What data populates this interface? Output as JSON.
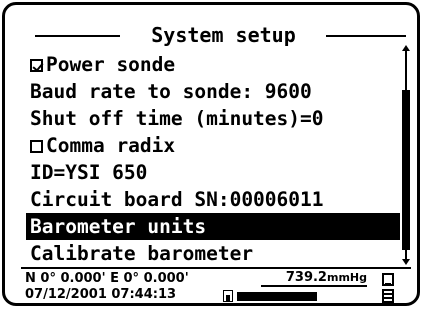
{
  "screen": {
    "title": "System setup",
    "items": [
      {
        "label": "Power sonde",
        "checkbox": true,
        "checked": true
      },
      {
        "label": "Baud rate to sonde: 9600"
      },
      {
        "label": "Shut off time (minutes)=0"
      },
      {
        "label": "Comma radix",
        "checkbox": true,
        "checked": false
      },
      {
        "label": "ID=YSI 650"
      },
      {
        "label": "Circuit board SN:00006011"
      },
      {
        "label": "Barometer units",
        "selected": true
      },
      {
        "label": "Calibrate barometer"
      }
    ]
  },
  "status": {
    "coords": "N 0° 0.000' E  0° 0.000'",
    "datetime": "07/12/2001 07:44:13",
    "baro_value": "739.2",
    "baro_unit": "mmHg",
    "battery_level": 1.0
  },
  "icons": {
    "checkbox": "checkbox-icon",
    "scroll_up": "scroll-up-icon",
    "scroll_down": "scroll-down-icon",
    "battery": "battery-icon",
    "device": "device-icon"
  }
}
